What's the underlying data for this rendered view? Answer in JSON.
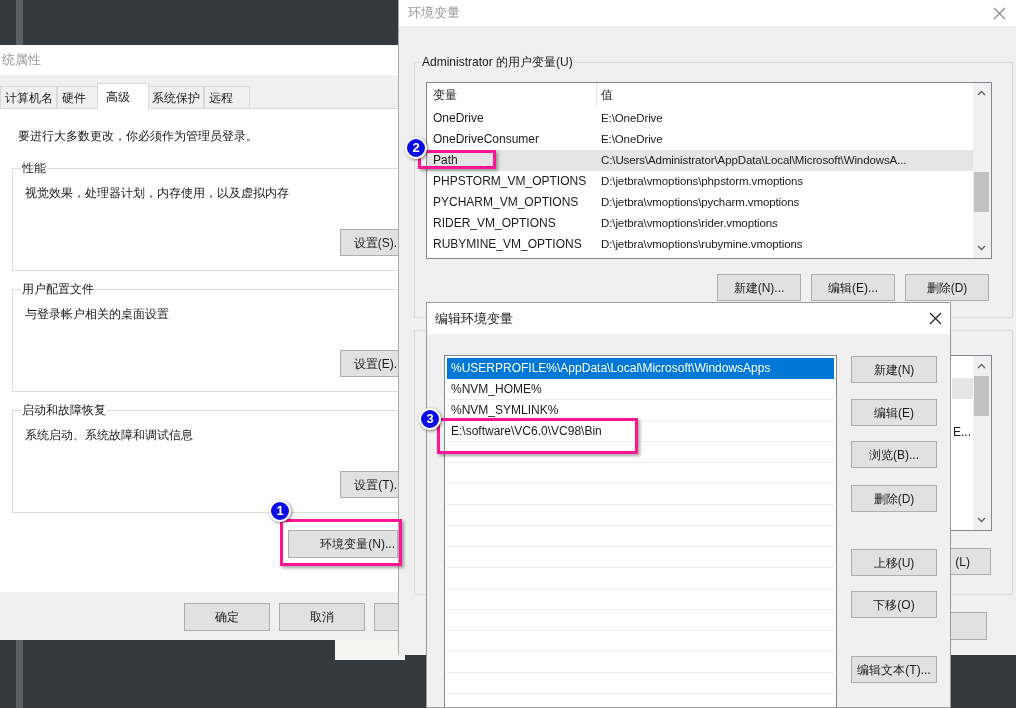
{
  "system_properties": {
    "title": "统属性",
    "tabs": [
      {
        "label": "计算机名",
        "selected": false
      },
      {
        "label": "硬件",
        "selected": false
      },
      {
        "label": "高级",
        "selected": true
      },
      {
        "label": "系统保护",
        "selected": false
      },
      {
        "label": "远程",
        "selected": false
      }
    ],
    "notice": "要进行大多数更改，你必须作为管理员登录。",
    "groups": [
      {
        "label": "性能",
        "description": "视觉效果，处理器计划，内存使用，以及虚拟内存",
        "button": "设置(S)."
      },
      {
        "label": "用户配置文件",
        "description": "与登录帐户相关的桌面设置",
        "button": "设置(E)."
      },
      {
        "label": "启动和故障恢复",
        "description": "系统启动、系统故障和调试信息",
        "button": "设置(T)."
      }
    ],
    "env_button": "环境变量(N)...",
    "footer_buttons": [
      "确定",
      "取消"
    ]
  },
  "environment_variables": {
    "title": "环境变量",
    "user_group": "Administrator 的用户变量(U)",
    "columns": [
      "变量",
      "值"
    ],
    "rows": [
      {
        "name": "OneDrive",
        "value": "E:\\OneDrive",
        "selected": false
      },
      {
        "name": "OneDriveConsumer",
        "value": "E:\\OneDrive",
        "selected": false
      },
      {
        "name": "Path",
        "value": "C:\\Users\\Administrator\\AppData\\Local\\Microsoft\\WindowsA...",
        "selected": true
      },
      {
        "name": "PHPSTORM_VM_OPTIONS",
        "value": "D:\\jetbra\\vmoptions\\phpstorm.vmoptions",
        "selected": false
      },
      {
        "name": "PYCHARM_VM_OPTIONS",
        "value": "D:\\jetbra\\vmoptions\\pycharm.vmoptions",
        "selected": false
      },
      {
        "name": "RIDER_VM_OPTIONS",
        "value": "D:\\jetbra\\vmoptions\\rider.vmoptions",
        "selected": false
      },
      {
        "name": "RUBYMINE_VM_OPTIONS",
        "value": "D:\\jetbra\\vmoptions\\rubymine.vmoptions",
        "selected": false
      }
    ],
    "buttons": [
      "新建(N)...",
      "编辑(E)...",
      "删除(D)"
    ],
    "system_list_fragment": "E...",
    "system_button_fragment": "(L)"
  },
  "edit_dialog": {
    "title": "编辑环境变量",
    "entries": [
      {
        "text": "%USERPROFILE%\\AppData\\Local\\Microsoft\\WindowsApps",
        "selected": true
      },
      {
        "text": "%NVM_HOME%",
        "selected": false
      },
      {
        "text": "%NVM_SYMLINK%",
        "selected": false
      },
      {
        "text": "E:\\software\\VC6.0\\VC98\\Bin",
        "selected": false
      }
    ],
    "buttons": [
      "新建(N)",
      "编辑(E)",
      "浏览(B)...",
      "删除(D)",
      "上移(U)",
      "下移(O)",
      "编辑文本(T)..."
    ]
  },
  "annotations": [
    {
      "number": "1"
    },
    {
      "number": "2"
    },
    {
      "number": "3"
    }
  ]
}
